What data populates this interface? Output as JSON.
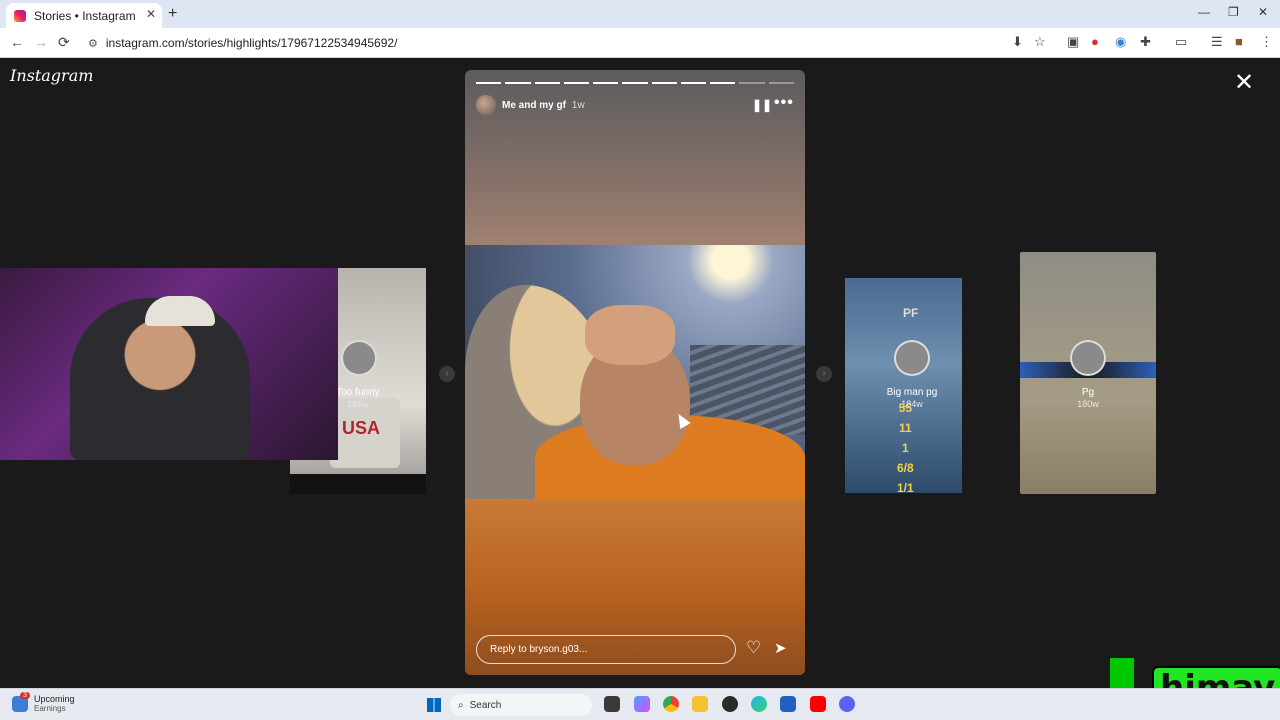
{
  "browser": {
    "tab_title": "Stories • Instagram",
    "url": "instagram.com/stories/highlights/17967122534945692/",
    "tab_close": "✕",
    "new_tab": "+",
    "window_controls": [
      "—",
      "❐",
      "✕"
    ],
    "nav": {
      "back": "←",
      "forward": "→",
      "reload": "⟳"
    }
  },
  "page": {
    "logo": "Instagram",
    "close": "✕"
  },
  "story": {
    "username": "Me and my gf",
    "time": "1w",
    "segments_total": 11,
    "segments_done": 9,
    "reply_placeholder": "Reply to bryson.g03...",
    "pause": "❚❚",
    "more": "•••",
    "like": "♡",
    "share": "➤"
  },
  "highlights": [
    {
      "title": "Too funny",
      "time": "186w",
      "shirt_text": "USA"
    },
    {
      "title": "Big man pg",
      "time": "184w",
      "label": "PF",
      "stats": [
        "55",
        "11",
        "1",
        "6/8",
        "1/1"
      ]
    },
    {
      "title": "Pg",
      "time": "180w"
    }
  ],
  "watermark": {
    "text": "himay"
  },
  "taskbar": {
    "widget_title": "Upcoming",
    "widget_sub": "Earnings",
    "widget_badge": "3",
    "search": "Search"
  },
  "colors": {
    "page_bg": "#1a1a1a",
    "accent_orange": "#dc7b20",
    "watermark_green": "#22e622"
  }
}
